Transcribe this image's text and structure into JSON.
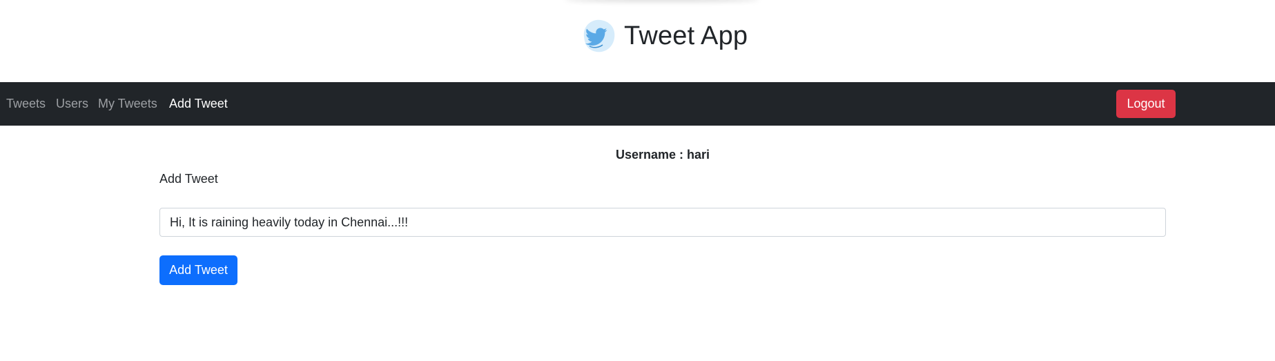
{
  "header": {
    "title": "Tweet App",
    "logo_icon": "twitter-bird-icon"
  },
  "navbar": {
    "links": [
      {
        "label": "Tweets",
        "active": false
      },
      {
        "label": "Users",
        "active": false
      },
      {
        "label": "My Tweets",
        "active": false
      },
      {
        "label": "Add Tweet",
        "active": true
      }
    ],
    "logout_label": "Logout"
  },
  "main": {
    "username_text": "Username : hari",
    "form_label": "Add Tweet",
    "tweet_input_value": "Hi, It is raining heavily today in Chennai...!!!",
    "submit_label": "Add Tweet"
  },
  "colors": {
    "navbar_bg": "#212529",
    "logout_red": "#dc3545",
    "primary_blue": "#0d6efd",
    "logo_bird": "#5aa9e6",
    "logo_bg": "#d6ecfb"
  }
}
